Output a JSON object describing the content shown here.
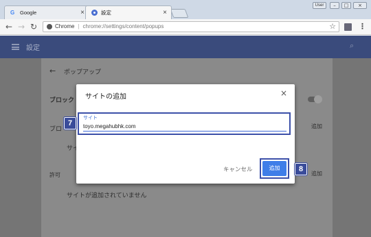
{
  "browser": {
    "tabs": [
      {
        "label": "Google",
        "icon": "google-icon"
      },
      {
        "label": "設定",
        "icon": "settings-gear-icon"
      }
    ],
    "user_badge": "User",
    "address": {
      "site": "Chrome",
      "url": "chrome://settings/content/popups"
    }
  },
  "settings": {
    "appbar_title": "設定",
    "page_title": "ポップアップ",
    "block_label": "ブロック (",
    "partial_1": "ブロ",
    "partial_2": "サイ",
    "allow_label": "許可",
    "no_sites_text": "サイトが追加されていません",
    "add_link_1": "追加",
    "add_link_2": "追加"
  },
  "dialog": {
    "title": "サイトの追加",
    "field_label": "サイト",
    "field_value": "toyo.megahubhk.com",
    "cancel_label": "キャンセル",
    "add_label": "追加"
  },
  "steps": {
    "step_a": "7",
    "step_b": "8"
  },
  "colors": {
    "appbar": "#3a4b7c",
    "accent": "#3f7ee8",
    "step_badge": "#3a4c9a"
  }
}
